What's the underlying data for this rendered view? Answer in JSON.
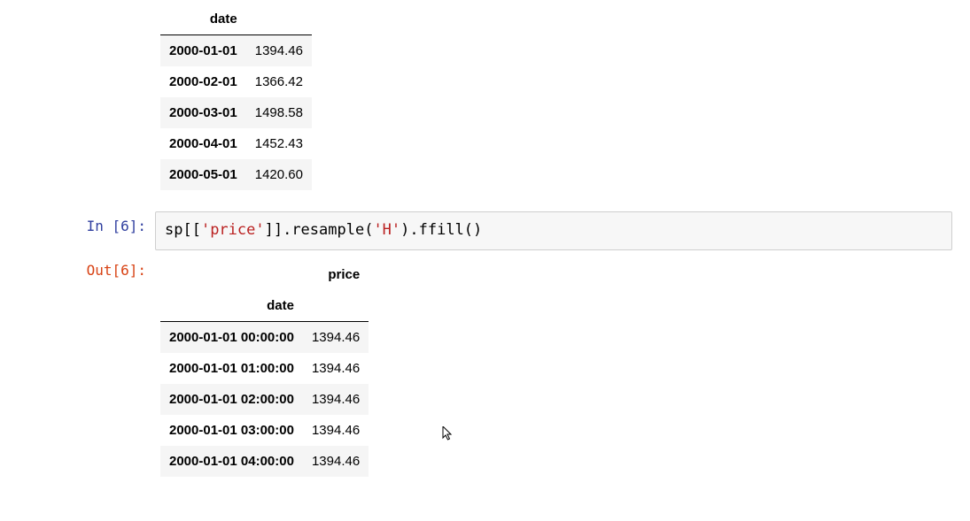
{
  "top_output": {
    "index_label": "date",
    "rows": [
      {
        "date": "2000-01-01",
        "value": "1394.46"
      },
      {
        "date": "2000-02-01",
        "value": "1366.42"
      },
      {
        "date": "2000-03-01",
        "value": "1498.58"
      },
      {
        "date": "2000-04-01",
        "value": "1452.43"
      },
      {
        "date": "2000-05-01",
        "value": "1420.60"
      }
    ]
  },
  "cell_in": {
    "prompt": "In [6]:",
    "code_parts": {
      "p1": "sp[[",
      "s1": "'price'",
      "p2": "]].resample(",
      "s2": "'H'",
      "p3": ").ffill()"
    }
  },
  "cell_out": {
    "prompt": "Out[6]:",
    "column_header": "price",
    "index_label": "date",
    "rows": [
      {
        "date": "2000-01-01 00:00:00",
        "value": "1394.46"
      },
      {
        "date": "2000-01-01 01:00:00",
        "value": "1394.46"
      },
      {
        "date": "2000-01-01 02:00:00",
        "value": "1394.46"
      },
      {
        "date": "2000-01-01 03:00:00",
        "value": "1394.46"
      },
      {
        "date": "2000-01-01 04:00:00",
        "value": "1394.46"
      }
    ]
  }
}
